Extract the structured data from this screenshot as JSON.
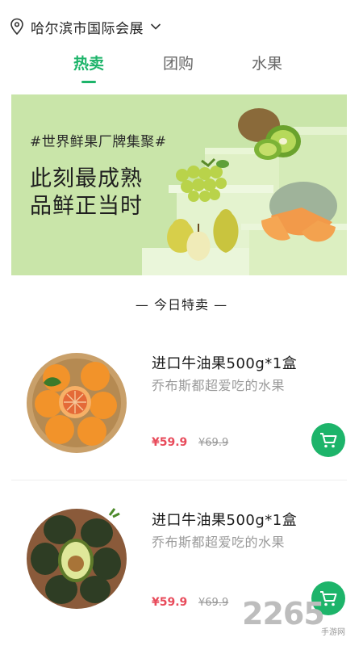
{
  "location": {
    "city": "哈尔滨市国际会展",
    "icon": "location-pin-icon"
  },
  "tabs": [
    {
      "label": "热卖",
      "active": true
    },
    {
      "label": "团购",
      "active": false
    },
    {
      "label": "水果",
      "active": false
    }
  ],
  "banner": {
    "tag": "#世界鲜果厂牌集聚#",
    "line1": "此刻最成熟",
    "line2": "品鲜正当时"
  },
  "section": {
    "title": "— 今日特卖 —"
  },
  "products": [
    {
      "name": "进口牛油果500g*1盒",
      "desc": "乔布斯都超爱吃的水果",
      "price": "¥59.9",
      "old_price": "¥69.9",
      "image": "oranges"
    },
    {
      "name": "进口牛油果500g*1盒",
      "desc": "乔布斯都超爱吃的水果",
      "price": "¥59.9",
      "old_price": "¥69.9",
      "image": "avocados"
    }
  ],
  "colors": {
    "accent": "#1db46a",
    "price": "#e84b5b",
    "banner_bg": "#c9e5a9"
  },
  "watermark": {
    "number": "2265",
    "sub": "手游网"
  }
}
